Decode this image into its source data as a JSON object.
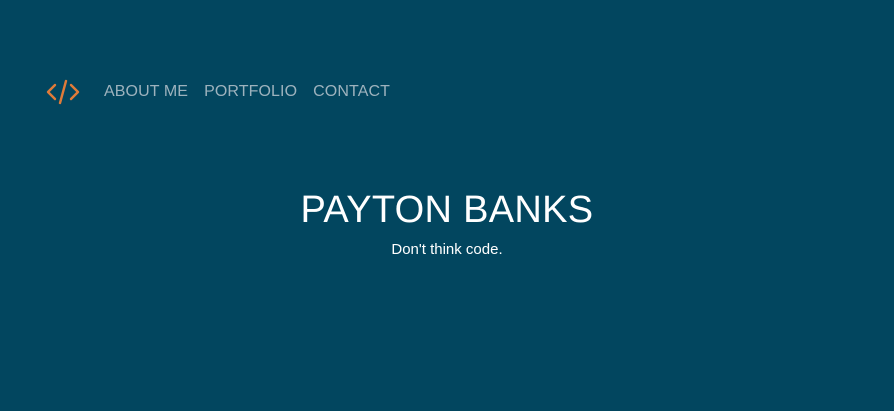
{
  "brand": {
    "logo_icon": "code-brackets-icon",
    "logo_color": "#e07b39"
  },
  "nav": {
    "items": [
      {
        "label": "ABOUT ME"
      },
      {
        "label": "PORTFOLIO"
      },
      {
        "label": "CONTACT"
      }
    ]
  },
  "hero": {
    "title": "PAYTON BANKS",
    "subtitle": "Don't think code."
  },
  "colors": {
    "background": "#02465f",
    "nav_text": "#9db2bd",
    "hero_text": "#ffffff",
    "accent": "#e07b39"
  }
}
